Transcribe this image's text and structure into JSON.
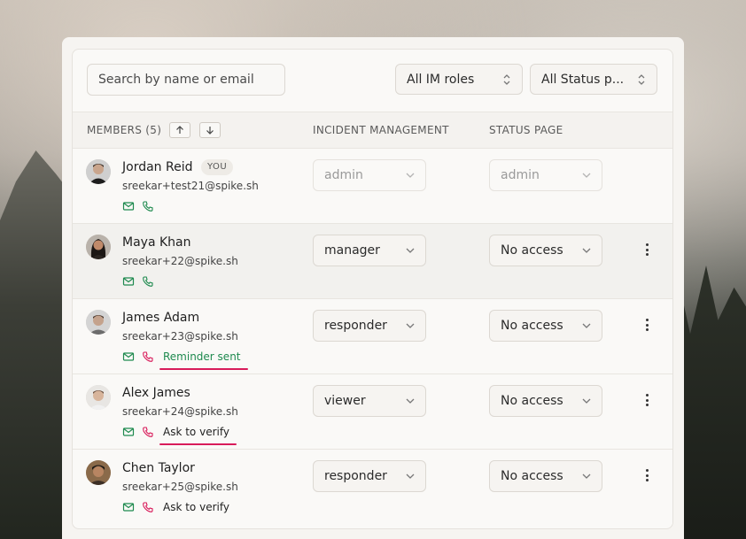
{
  "toolbar": {
    "search_placeholder": "Search by name or email",
    "im_roles_filter": "All IM roles",
    "status_filter": "All Status p..."
  },
  "table": {
    "headers": {
      "members": "MEMBERS (5)",
      "incident_management": "INCIDENT MANAGEMENT",
      "status_page": "STATUS PAGE"
    },
    "rows": [
      {
        "name": "Jordan Reid",
        "badge": "YOU",
        "email": "sreekar+test21@spike.sh",
        "phone_verified": true,
        "phone_note": "",
        "im_role": "admin",
        "status_page_role": "admin",
        "editable": false
      },
      {
        "name": "Maya Khan",
        "badge": "",
        "email": "sreekar+22@spike.sh",
        "phone_verified": true,
        "phone_note": "",
        "im_role": "manager",
        "status_page_role": "No access",
        "editable": true
      },
      {
        "name": "James Adam",
        "badge": "",
        "email": "sreekar+23@spike.sh",
        "phone_verified": false,
        "phone_note": "Reminder sent",
        "im_role": "responder",
        "status_page_role": "No access",
        "editable": true
      },
      {
        "name": "Alex James",
        "badge": "",
        "email": "sreekar+24@spike.sh",
        "phone_verified": false,
        "phone_note": "Ask to verify",
        "im_role": "viewer",
        "status_page_role": "No access",
        "editable": true
      },
      {
        "name": "Chen Taylor",
        "badge": "",
        "email": "sreekar+25@spike.sh",
        "phone_verified": false,
        "phone_note": "Ask to verify",
        "im_role": "responder",
        "status_page_role": "No access",
        "editable": true
      }
    ]
  },
  "colors": {
    "verified_green": "#1f8a4f",
    "unverified_red": "#d81b5a",
    "panel_bg": "#faf9f7"
  }
}
